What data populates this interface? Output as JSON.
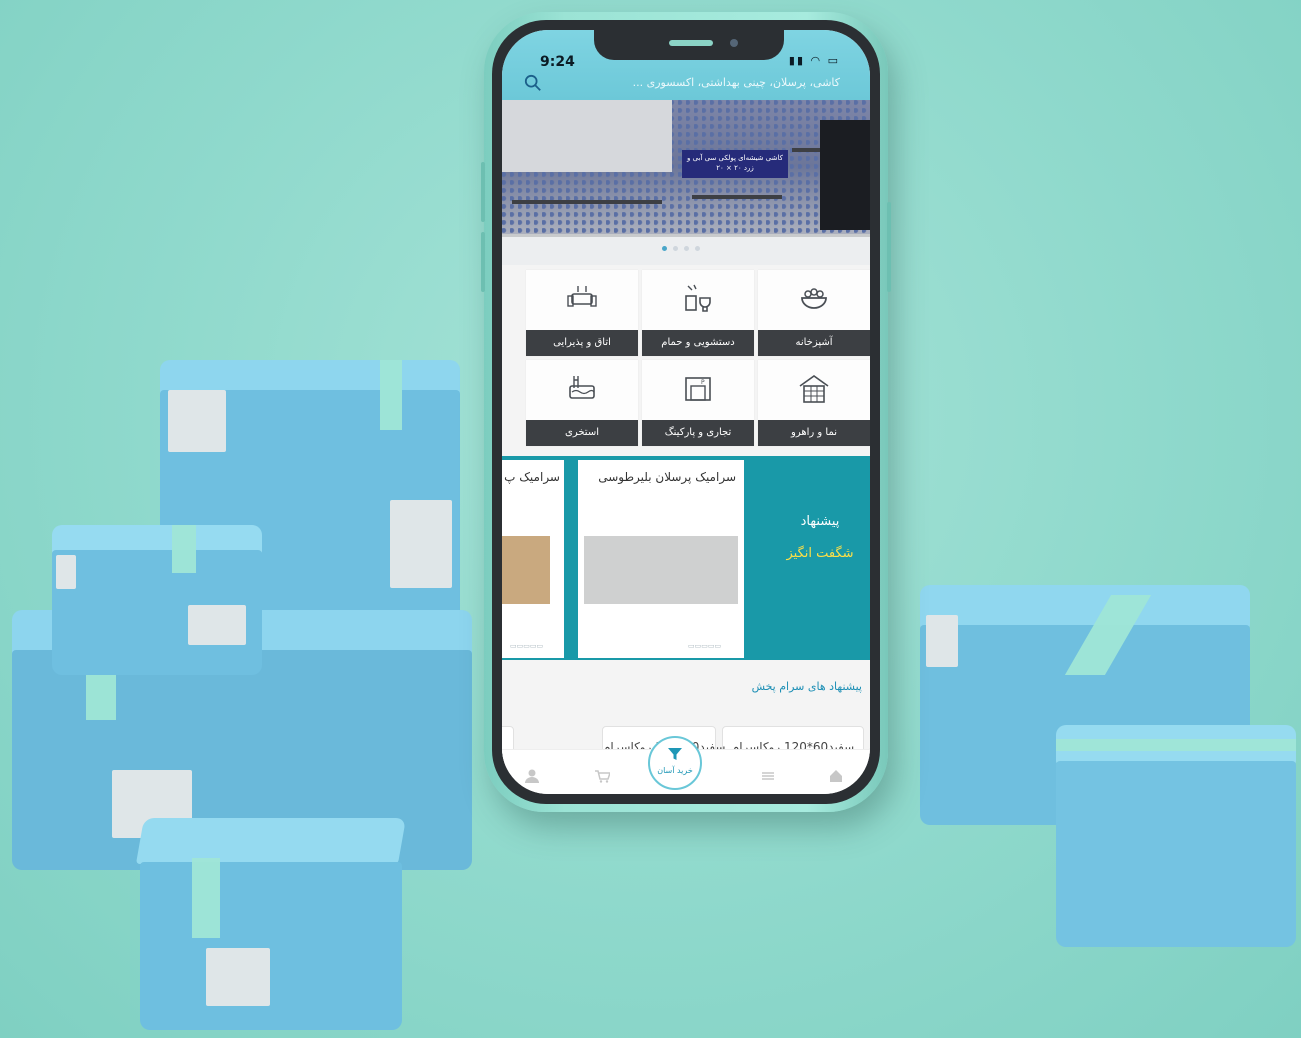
{
  "status_bar": {
    "time": "9:24"
  },
  "search": {
    "placeholder": "کاشی، پرسلان، چینی بهداشتی، اکسسوری ..."
  },
  "banner": {
    "promo_text": "کاشی شیشه‌ای پولکی سی\nآبی و زرد ۲۰ × ۲۰"
  },
  "categories": [
    {
      "label": "آشپزخانه",
      "icon": "bowl-icon"
    },
    {
      "label": "دستشویی و حمام",
      "icon": "bathroom-icon"
    },
    {
      "label": "اتاق و پذیرایی",
      "icon": "living-room-icon"
    },
    {
      "label": "نما و راهرو",
      "icon": "facade-icon"
    },
    {
      "label": "تجاری و پارکینگ",
      "icon": "parking-icon"
    },
    {
      "label": "استخری",
      "icon": "pool-icon"
    }
  ],
  "offers": {
    "title_line1": "پیشنهاد",
    "title_line2": "شگفت انگیز",
    "products": [
      {
        "title": "سرامیک پرسلان بلیرطوسی",
        "image_color": "#cfd0d0"
      },
      {
        "title": "سرامیک پ",
        "image_color": "#c9a97f"
      }
    ]
  },
  "section": {
    "title": "پیشنهاد های سرام پخش"
  },
  "suggestions": [
    {
      "title": "سفید60*120 روکاسرام"
    },
    {
      "title": "سفید60*120 روکاسرام"
    }
  ],
  "bottom_nav": {
    "fab_label": "خرید آسان"
  },
  "colors": {
    "brand_teal": "#1999a8",
    "accent_yellow": "#ffe046",
    "bar_blue": "#6cc8d8",
    "box_blue": "#79c6e6"
  }
}
